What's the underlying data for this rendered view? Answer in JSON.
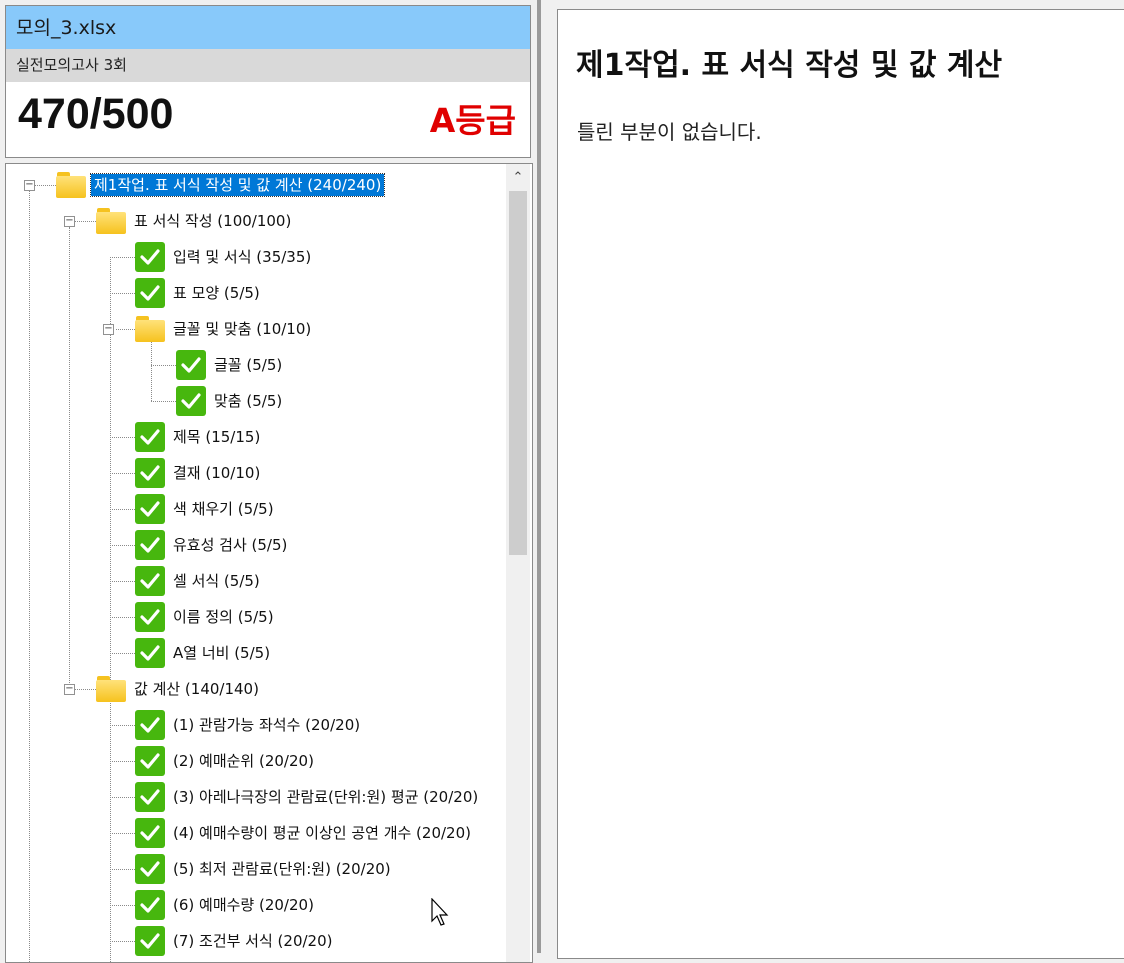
{
  "file_name": "모의_3.xlsx",
  "exam_name": "실전모의고사 3회",
  "score": "470/500",
  "grade": "A등급",
  "colors": {
    "header": "#88c9fa",
    "grade": "#e00000",
    "check": "#47b70e",
    "selection": "#0078d7"
  },
  "tree": [
    {
      "label": "제1작업. 표 서식 작성 및 값 계산 (240/240)",
      "icon": "folder-icon",
      "level": 0,
      "expander": "minus",
      "selected": true
    },
    {
      "label": "표 서식 작성 (100/100)",
      "icon": "folder-icon",
      "level": 1,
      "expander": "minus"
    },
    {
      "label": "입력 및 서식 (35/35)",
      "icon": "check-icon",
      "level": 2
    },
    {
      "label": "표 모양 (5/5)",
      "icon": "check-icon",
      "level": 2
    },
    {
      "label": "글꼴 및 맞춤 (10/10)",
      "icon": "folder-icon",
      "level": 2,
      "expander": "minus"
    },
    {
      "label": "글꼴 (5/5)",
      "icon": "check-icon",
      "level": 3
    },
    {
      "label": "맞춤 (5/5)",
      "icon": "check-icon",
      "level": 3
    },
    {
      "label": "제목 (15/15)",
      "icon": "check-icon",
      "level": 2
    },
    {
      "label": "결재 (10/10)",
      "icon": "check-icon",
      "level": 2
    },
    {
      "label": "색 채우기 (5/5)",
      "icon": "check-icon",
      "level": 2
    },
    {
      "label": "유효성 검사 (5/5)",
      "icon": "check-icon",
      "level": 2
    },
    {
      "label": "셀 서식 (5/5)",
      "icon": "check-icon",
      "level": 2
    },
    {
      "label": "이름 정의 (5/5)",
      "icon": "check-icon",
      "level": 2
    },
    {
      "label": "A열 너비 (5/5)",
      "icon": "check-icon",
      "level": 2
    },
    {
      "label": "값 계산 (140/140)",
      "icon": "folder-icon",
      "level": 1,
      "expander": "minus"
    },
    {
      "label": "(1) 관람가능 좌석수 (20/20)",
      "icon": "check-icon",
      "level": 2
    },
    {
      "label": "(2) 예매순위 (20/20)",
      "icon": "check-icon",
      "level": 2
    },
    {
      "label": "(3) 아레나극장의 관람료(단위:원) 평균 (20/20)",
      "icon": "check-icon",
      "level": 2
    },
    {
      "label": "(4) 예매수량이 평균 이상인 공연 개수 (20/20)",
      "icon": "check-icon",
      "level": 2
    },
    {
      "label": "(5) 최저 관람료(단위:원) (20/20)",
      "icon": "check-icon",
      "level": 2
    },
    {
      "label": "(6) 예매수량 (20/20)",
      "icon": "check-icon",
      "level": 2
    },
    {
      "label": "(7) 조건부 서식 (20/20)",
      "icon": "check-icon",
      "level": 2
    }
  ],
  "detail": {
    "title": "제1작업. 표 서식 작성 및 값 계산",
    "message": "틀린 부분이 없습니다."
  }
}
